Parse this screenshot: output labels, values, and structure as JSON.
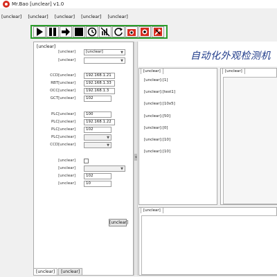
{
  "window": {
    "title": "Mr.Bao [unclear] v1.0"
  },
  "menu": {
    "items": [
      {
        "name": "menu-window",
        "label": "[unclear]"
      },
      {
        "name": "menu-info",
        "label": "[unclear]"
      },
      {
        "name": "menu-data",
        "label": "[unclear]"
      },
      {
        "name": "menu-language",
        "label": "[unclear]"
      },
      {
        "name": "menu-version",
        "label": "[unclear]"
      }
    ]
  },
  "toolbar": {
    "buttons": [
      {
        "name": "start-button",
        "icon": "play-icon"
      },
      {
        "name": "pause-button",
        "icon": "pause-icon"
      },
      {
        "name": "step-button",
        "icon": "arrow-right-icon"
      },
      {
        "name": "stop-button",
        "icon": "stop-icon"
      },
      {
        "name": "home-button",
        "icon": "clock-reset-icon"
      },
      {
        "name": "reset-button",
        "icon": "no-signal-icon"
      },
      {
        "name": "refresh-button",
        "icon": "refresh-icon"
      },
      {
        "name": "camera-button",
        "icon": "camera-icon"
      },
      {
        "name": "record-button",
        "icon": "record-icon"
      },
      {
        "name": "tools-button",
        "icon": "tools-icon"
      }
    ]
  },
  "params": {
    "group_title": "[unclear]",
    "fields": [
      {
        "name": "station-select",
        "label": "[unclear]",
        "value": "[unclear]",
        "type": "select"
      },
      {
        "name": "project-select",
        "label": "[unclear]",
        "value": "",
        "type": "select"
      },
      {
        "name": "ccd-ip-field",
        "label": "CCD[unclear]",
        "value": "192.168.1.21",
        "type": "text"
      },
      {
        "name": "rbt-ip-field",
        "label": "RBT[unclear]",
        "value": "192.168.1.33",
        "type": "text"
      },
      {
        "name": "occ-ip-field",
        "label": "OCC[unclear]",
        "value": "192.168.1.3",
        "type": "text"
      },
      {
        "name": "gct-port-field",
        "label": "GCT[unclear]",
        "value": "102",
        "type": "text"
      },
      {
        "name": "plc-interval-field",
        "label": "PLC[unclear]",
        "value": "100",
        "type": "text"
      },
      {
        "name": "plc-ip-field",
        "label": "PLC[unclear]",
        "value": "192.168.1.22",
        "type": "text"
      },
      {
        "name": "plc-port-field",
        "label": "PLC[unclear]",
        "value": "102",
        "type": "text"
      },
      {
        "name": "plc-mode-select",
        "label": "PLC[unclear]",
        "value": "",
        "type": "select-disabled"
      },
      {
        "name": "ccd-vendor-select",
        "label": "CCD[unclear]",
        "value": "",
        "type": "select-disabled"
      },
      {
        "name": "test-mode-checkbox",
        "label": "[unclear]",
        "value": "",
        "type": "checkbox"
      },
      {
        "name": "server-address-select",
        "label": "[unclear]",
        "value": "",
        "type": "select-disabled"
      },
      {
        "name": "server-port-field",
        "label": "[unclear]",
        "value": "102",
        "type": "text"
      },
      {
        "name": "timeout-field",
        "label": "[unclear]",
        "value": "10",
        "type": "text"
      }
    ],
    "apply_label": "[unclear]"
  },
  "bottom_tabs": [
    {
      "name": "tab-settings",
      "label": "[unclear]"
    },
    {
      "name": "tab-status",
      "label": "[unclear]"
    }
  ],
  "banner": {
    "text": "自动化外观检测机"
  },
  "order_panel": {
    "tab_label": "[unclear]",
    "lines": [
      "[unclear]:[1]",
      "[unclear]:[test1]",
      "[unclear]:[10x5]",
      "[unclear]:[50]",
      "[unclear]:[0]",
      "[unclear]:[10]",
      "[unclear]:[10]"
    ]
  },
  "state_panel": {
    "tab_label": "[unclear]"
  },
  "log_panel": {
    "tab_label": "[unclear]"
  },
  "colors": {
    "toolbar_border": "#2b9d2b",
    "banner_text": "#1f3b8a",
    "logo": "#d62b1f"
  }
}
